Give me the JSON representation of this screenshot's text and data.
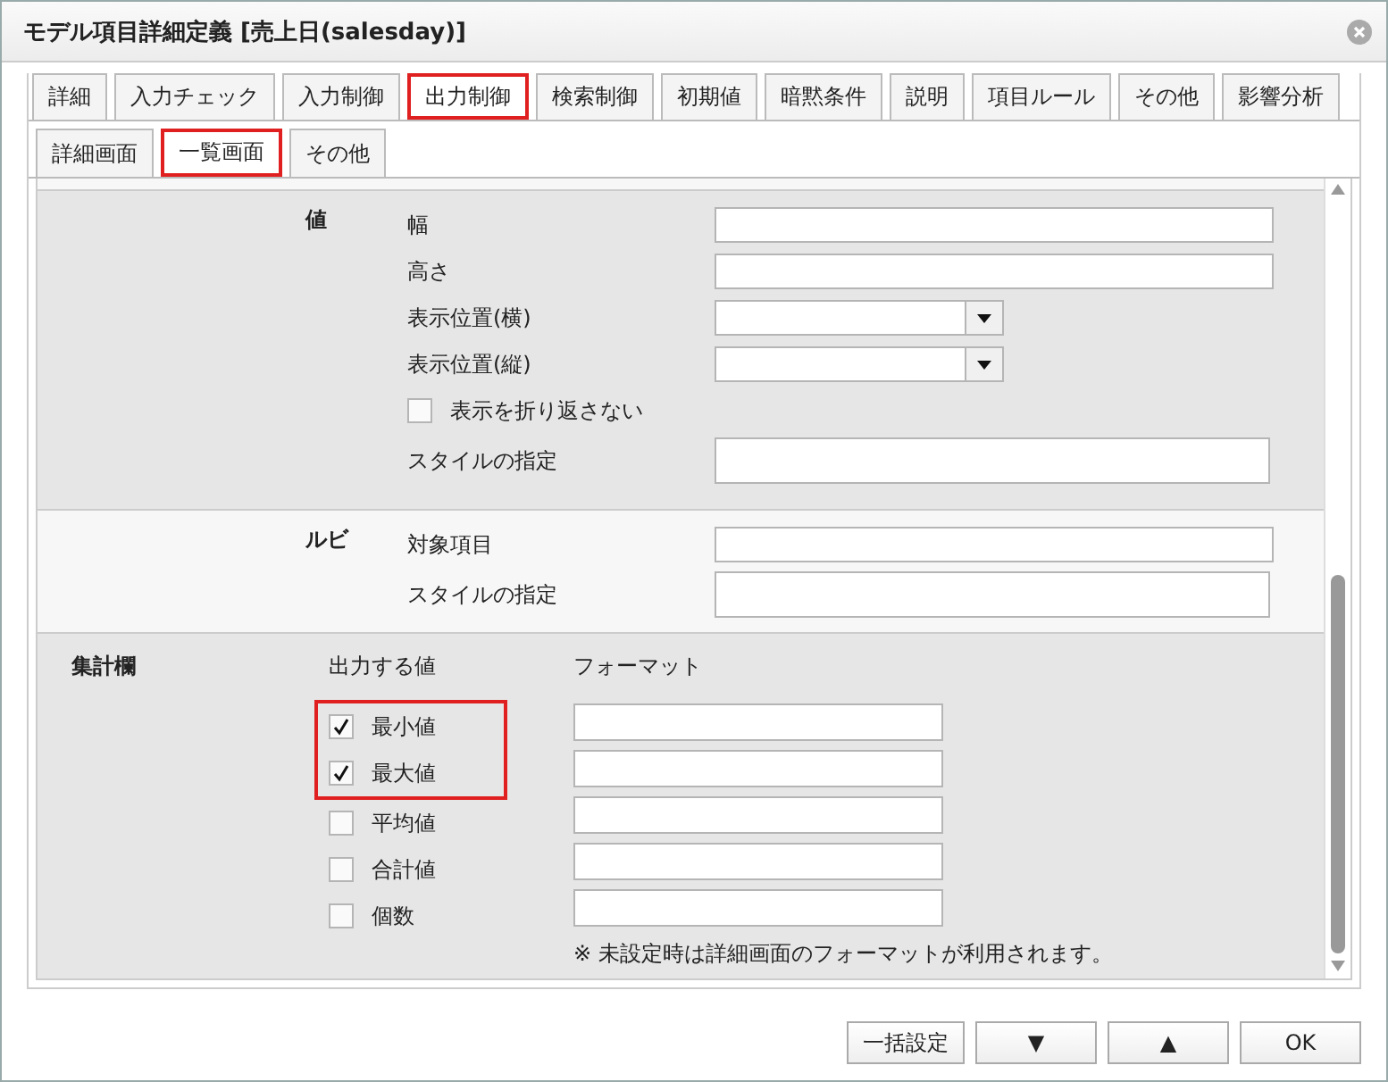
{
  "window": {
    "title": "モデル項目詳細定義 [売上日(salesday)]"
  },
  "tabs": [
    {
      "label": "詳細",
      "selected": false
    },
    {
      "label": "入力チェック",
      "selected": false
    },
    {
      "label": "入力制御",
      "selected": false
    },
    {
      "label": "出力制御",
      "selected": true
    },
    {
      "label": "検索制御",
      "selected": false
    },
    {
      "label": "初期値",
      "selected": false
    },
    {
      "label": "暗黙条件",
      "selected": false
    },
    {
      "label": "説明",
      "selected": false
    },
    {
      "label": "項目ルール",
      "selected": false
    },
    {
      "label": "その他",
      "selected": false
    },
    {
      "label": "影響分析",
      "selected": false
    }
  ],
  "subtabs": [
    {
      "label": "詳細画面",
      "selected": false
    },
    {
      "label": "一覧画面",
      "selected": true
    },
    {
      "label": "その他",
      "selected": false
    }
  ],
  "sections": [
    {
      "label": "値",
      "rows": [
        {
          "kind": "text",
          "label": "幅"
        },
        {
          "kind": "text",
          "label": "高さ"
        },
        {
          "kind": "select",
          "label": "表示位置(横)"
        },
        {
          "kind": "select",
          "label": "表示位置(縦)"
        },
        {
          "kind": "checkbox",
          "label": "表示を折り返さない",
          "checked": false
        },
        {
          "kind": "textarea",
          "label": "スタイルの指定"
        }
      ]
    },
    {
      "label": "ルビ",
      "rows": [
        {
          "kind": "text",
          "label": "対象項目"
        },
        {
          "kind": "textarea",
          "label": "スタイルの指定"
        }
      ]
    }
  ],
  "aggregate": {
    "label": "集計欄",
    "column_headers": [
      "出力する値",
      "フォーマット"
    ],
    "rows": [
      {
        "label": "最小値",
        "checked": true,
        "highlighted": true
      },
      {
        "label": "最大値",
        "checked": true,
        "highlighted": true
      },
      {
        "label": "平均値",
        "checked": false,
        "highlighted": false
      },
      {
        "label": "合計値",
        "checked": false,
        "highlighted": false
      },
      {
        "label": "個数",
        "checked": false,
        "highlighted": false
      }
    ],
    "note": "※ 未設定時は詳細画面のフォーマットが利用されます。"
  },
  "buttons": [
    "一括設定",
    "▼",
    "▲",
    "OK"
  ]
}
